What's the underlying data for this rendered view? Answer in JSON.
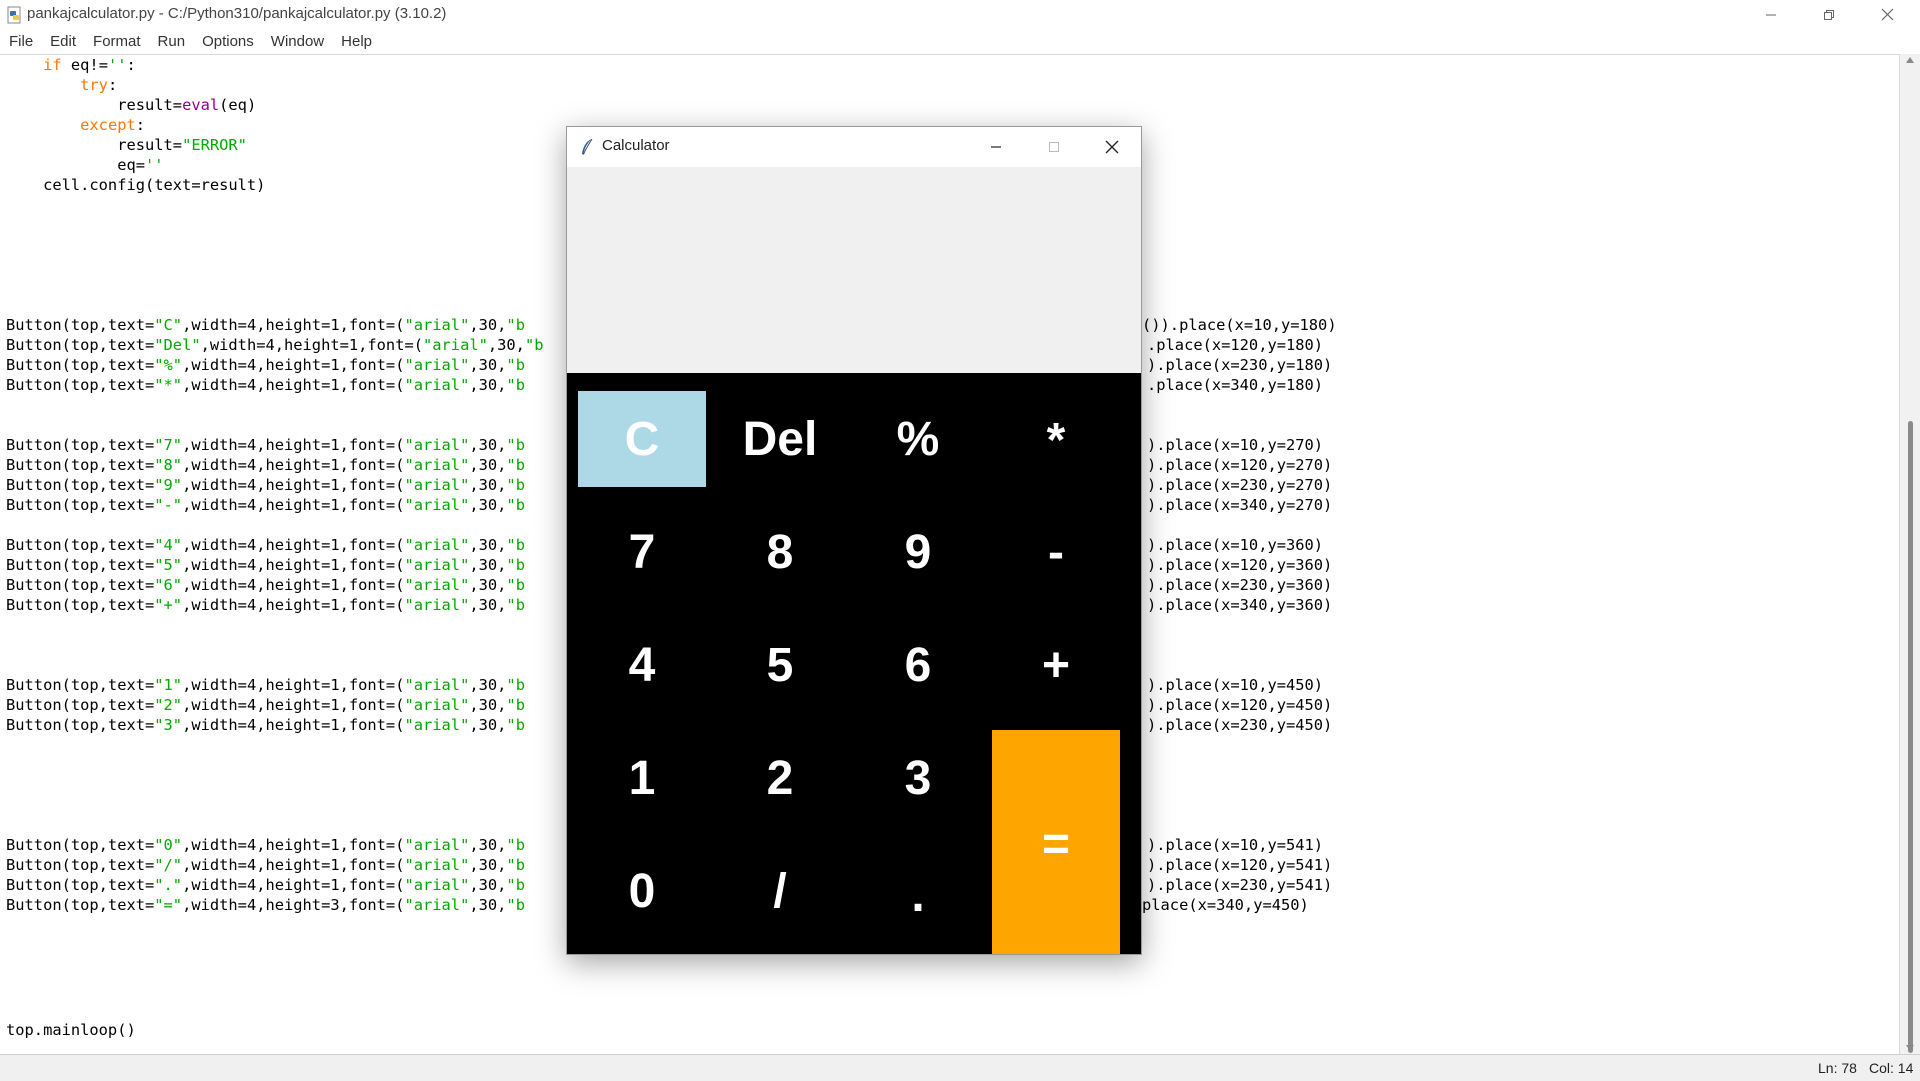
{
  "editor_window": {
    "title": "pankajcalculator.py - C:/Python310/pankajcalculator.py (3.10.2)",
    "menu": [
      "File",
      "Edit",
      "Format",
      "Run",
      "Options",
      "Window",
      "Help"
    ],
    "code_top": [
      {
        "segments": [
          {
            "t": "    "
          },
          {
            "t": "if",
            "c": "kw"
          },
          {
            "t": " eq!="
          },
          {
            "t": "''",
            "c": "str"
          },
          {
            "t": ":"
          }
        ]
      },
      {
        "segments": [
          {
            "t": "        "
          },
          {
            "t": "try",
            "c": "kw"
          },
          {
            "t": ":"
          }
        ]
      },
      {
        "segments": [
          {
            "t": "            result="
          },
          {
            "t": "eval",
            "c": "bi"
          },
          {
            "t": "(eq)"
          }
        ]
      },
      {
        "segments": [
          {
            "t": "        "
          },
          {
            "t": "except",
            "c": "kw"
          },
          {
            "t": ":"
          }
        ]
      },
      {
        "segments": [
          {
            "t": "            result="
          },
          {
            "t": "\"ERROR\"",
            "c": "str"
          }
        ]
      },
      {
        "segments": [
          {
            "t": "            eq="
          },
          {
            "t": "''",
            "c": "str"
          }
        ]
      },
      {
        "segments": [
          {
            "t": "    cell.config(text=result)"
          }
        ]
      }
    ],
    "button_lines": [
      {
        "label": "C",
        "height": "1",
        "place": "()).place(x=10,y=180)",
        "row": 0
      },
      {
        "label": "Del",
        "height": "1",
        "place": ".place(x=120,y=180)",
        "row": 1
      },
      {
        "label": "%",
        "height": "1",
        "place": ").place(x=230,y=180)",
        "row": 2
      },
      {
        "label": "*",
        "height": "1",
        "place": ".place(x=340,y=180)",
        "row": 3
      },
      {
        "label": "7",
        "height": "1",
        "place": ").place(x=10,y=270)",
        "row": 6
      },
      {
        "label": "8",
        "height": "1",
        "place": ").place(x=120,y=270)",
        "row": 7
      },
      {
        "label": "9",
        "height": "1",
        "place": ").place(x=230,y=270)",
        "row": 8
      },
      {
        "label": "-",
        "height": "1",
        "place": ").place(x=340,y=270)",
        "row": 9
      },
      {
        "label": "4",
        "height": "1",
        "place": ").place(x=10,y=360)",
        "row": 11
      },
      {
        "label": "5",
        "height": "1",
        "place": ").place(x=120,y=360)",
        "row": 12
      },
      {
        "label": "6",
        "height": "1",
        "place": ").place(x=230,y=360)",
        "row": 13
      },
      {
        "label": "+",
        "height": "1",
        "place": ").place(x=340,y=360)",
        "row": 14
      },
      {
        "label": "1",
        "height": "1",
        "place": ").place(x=10,y=450)",
        "row": 18
      },
      {
        "label": "2",
        "height": "1",
        "place": ").place(x=120,y=450)",
        "row": 19
      },
      {
        "label": "3",
        "height": "1",
        "place": ").place(x=230,y=450)",
        "row": 20
      },
      {
        "label": "0",
        "height": "1",
        "place": ").place(x=10,y=541)",
        "row": 26
      },
      {
        "label": "/",
        "height": "1",
        "place": ").place(x=120,y=541)",
        "row": 27
      },
      {
        "label": ".",
        "height": "1",
        "place": ").place(x=230,y=541)",
        "row": 28
      },
      {
        "label": "=",
        "height": "3",
        "place": "place(x=340,y=450)",
        "row": 29
      }
    ],
    "code_bottom": "top.mainloop()",
    "status": {
      "line": "Ln: 78",
      "col": "Col: 14"
    }
  },
  "calculator": {
    "title": "Calculator",
    "display": "",
    "keys": [
      {
        "label": "C",
        "name": "key-clear",
        "col": 0,
        "row": 0,
        "variant": "clear"
      },
      {
        "label": "Del",
        "name": "key-delete",
        "col": 1,
        "row": 0
      },
      {
        "label": "%",
        "name": "key-percent",
        "col": 2,
        "row": 0
      },
      {
        "label": "*",
        "name": "key-multiply",
        "col": 3,
        "row": 0
      },
      {
        "label": "7",
        "name": "key-7",
        "col": 0,
        "row": 1
      },
      {
        "label": "8",
        "name": "key-8",
        "col": 1,
        "row": 1
      },
      {
        "label": "9",
        "name": "key-9",
        "col": 2,
        "row": 1
      },
      {
        "label": "-",
        "name": "key-minus",
        "col": 3,
        "row": 1
      },
      {
        "label": "4",
        "name": "key-4",
        "col": 0,
        "row": 2
      },
      {
        "label": "5",
        "name": "key-5",
        "col": 1,
        "row": 2
      },
      {
        "label": "6",
        "name": "key-6",
        "col": 2,
        "row": 2
      },
      {
        "label": "+",
        "name": "key-plus",
        "col": 3,
        "row": 2
      },
      {
        "label": "1",
        "name": "key-1",
        "col": 0,
        "row": 3
      },
      {
        "label": "2",
        "name": "key-2",
        "col": 1,
        "row": 3
      },
      {
        "label": "3",
        "name": "key-3",
        "col": 2,
        "row": 3
      },
      {
        "label": "0",
        "name": "key-0",
        "col": 0,
        "row": 4
      },
      {
        "label": "/",
        "name": "key-divide",
        "col": 1,
        "row": 4
      },
      {
        "label": ".",
        "name": "key-decimal",
        "col": 2,
        "row": 4
      },
      {
        "label": "=",
        "name": "key-equals",
        "col": 3,
        "row": 3,
        "rowspan": 2,
        "variant": "equals"
      }
    ],
    "colors": {
      "clear": "#add8e6",
      "equals": "#ffa500",
      "keypad": "#000000",
      "display": "#f0f0f0"
    }
  }
}
